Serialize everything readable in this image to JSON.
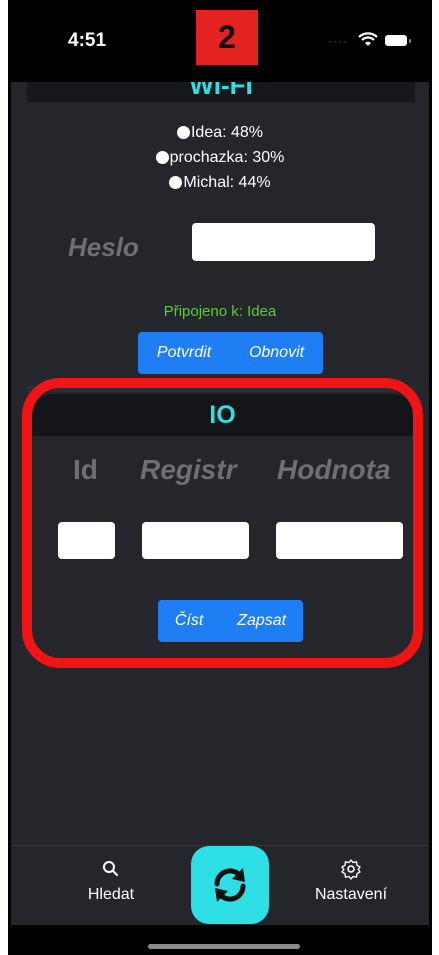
{
  "status_bar": {
    "time": "4:51",
    "step_badge": "2"
  },
  "wifi": {
    "title": "WI-FI",
    "networks": [
      {
        "label": "Idea: 48%"
      },
      {
        "label": "prochazka: 30%"
      },
      {
        "label": "Michal: 44%"
      }
    ],
    "password_label": "Heslo",
    "password_value": "",
    "connected_text": "Připojeno k: Idea",
    "confirm_label": "Potvrdit",
    "refresh_label": "Obnovit"
  },
  "io": {
    "title": "IO",
    "columns": {
      "id": "Id",
      "register": "Registr",
      "value": "Hodnota"
    },
    "id_value": "",
    "register_value": "",
    "value_value": "",
    "read_label": "Číst",
    "write_label": "Zapsat"
  },
  "tabbar": {
    "search_label": "Hledat",
    "settings_label": "Nastavení"
  },
  "colors": {
    "accent_cyan": "#2ee0e6",
    "button_blue": "#1e7ff5",
    "connected_green": "#56d12a",
    "highlight_red": "#f01414",
    "background": "#24262c"
  },
  "icons": [
    "wifi-icon",
    "battery-icon",
    "search-icon",
    "sync-icon",
    "gear-icon"
  ]
}
